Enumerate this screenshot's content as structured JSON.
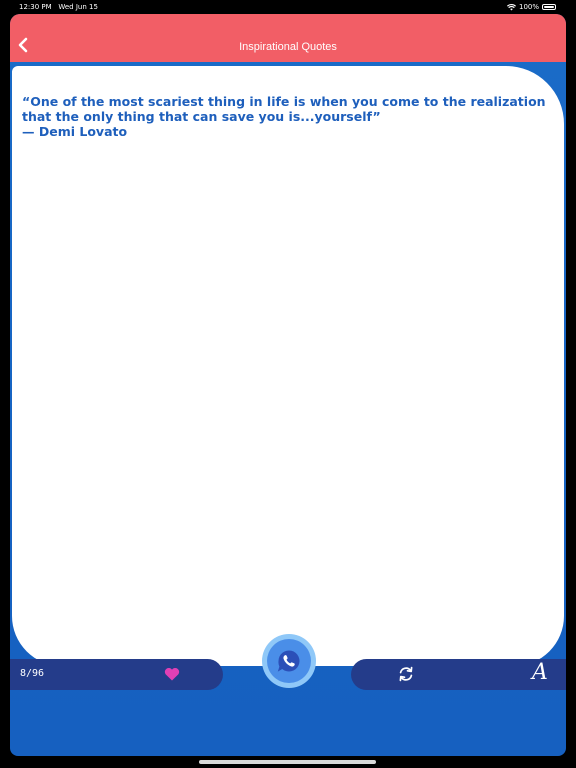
{
  "status": {
    "time": "12:30 PM",
    "date": "Wed Jun 15",
    "battery": "100%"
  },
  "nav": {
    "title": "Inspirational Quotes"
  },
  "quote": {
    "text": "“One of the most scariest thing in life is when you come to the realization that the only thing that can save you is...yourself”",
    "author": "— Demi Lovato"
  },
  "toolbar": {
    "counter": "8/96",
    "font_button": "A"
  },
  "icons": {
    "back": "chevron-left-icon",
    "favorite": "heart-icon",
    "share": "whatsapp-icon",
    "refresh": "refresh-icon",
    "font": "font-size-icon"
  },
  "colors": {
    "nav_bar": "#f25e66",
    "background": "#1b6cc8",
    "toolbar": "#243c8a",
    "quote_text": "#1e5fbc",
    "heart": "#e040b5"
  }
}
